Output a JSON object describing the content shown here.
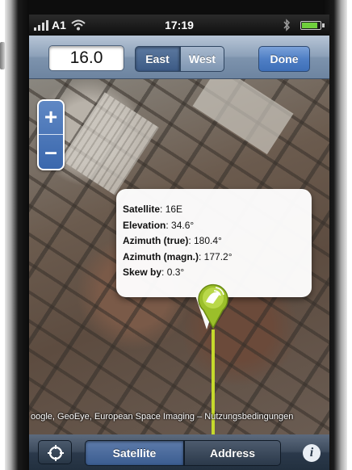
{
  "status_bar": {
    "carrier": "A1",
    "time": "17:19",
    "battery_level": 0.85
  },
  "toolbar": {
    "value": "16.0",
    "segments": [
      "East",
      "West"
    ],
    "selected_segment": "East",
    "done_label": "Done"
  },
  "map": {
    "zoom_in_label": "+",
    "zoom_out_label": "–",
    "callout": {
      "satellite_label": "Satellite",
      "satellite_value": ": 16E",
      "elevation_label": "Elevation",
      "elevation_value": ": 34.6°",
      "azimuth_true_label": "Azimuth (true)",
      "azimuth_true_value": ": 180.4°",
      "azimuth_magn_label": "Azimuth (magn.)",
      "azimuth_magn_value": ": 177.2°",
      "skew_label": "Skew by",
      "skew_value": ": 0.3°"
    },
    "attribution": "oogle, GeoEye, European Space Imaging – Nutzungsbedingungen",
    "line_color": "#c5d92c",
    "pin_color": "#9bbf2a"
  },
  "bottom_bar": {
    "tabs": [
      "Satellite",
      "Address"
    ],
    "selected_tab": "Satellite",
    "info_label": "i",
    "locate_icon": "crosshair-icon"
  }
}
